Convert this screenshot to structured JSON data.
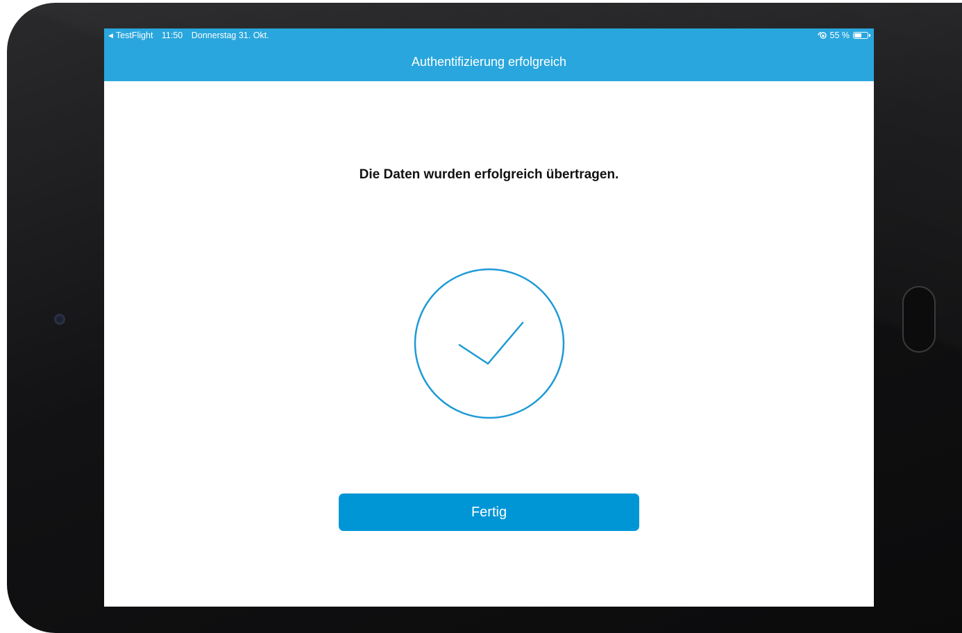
{
  "status_bar": {
    "back_app": "TestFlight",
    "time": "11:50",
    "date": "Donnerstag 31. Okt.",
    "battery_text": "55 %",
    "battery_level": 0.55,
    "back_icon": "back-triangle-icon",
    "orientation_icon": "orientation-lock-icon"
  },
  "navigation": {
    "title": "Authentifizierung erfolgreich"
  },
  "content": {
    "message": "Die Daten wurden erfolgreich übertragen.",
    "status_icon": "checkmark-circle-icon",
    "done_button_label": "Fertig"
  },
  "colors": {
    "header": "#29a6dd",
    "accent": "#0096d6",
    "check_stroke": "#1d9ad6"
  }
}
